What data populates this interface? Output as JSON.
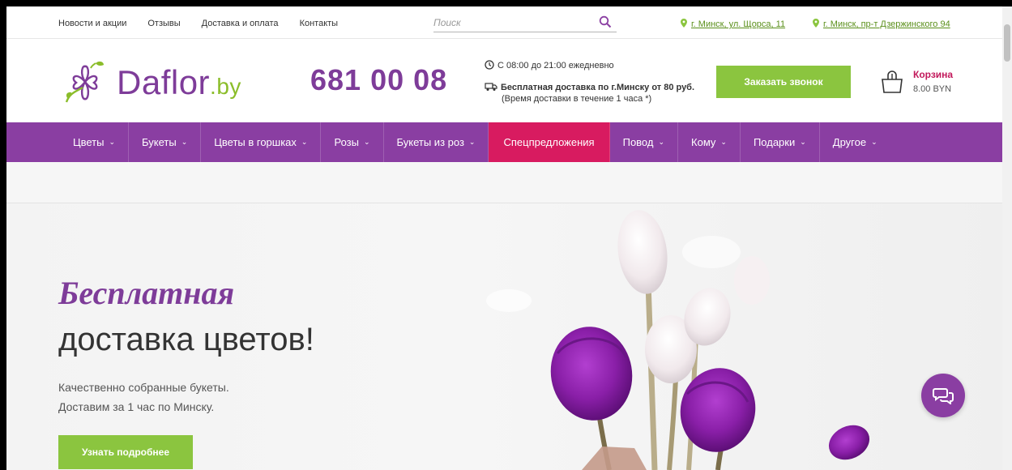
{
  "topbar": {
    "links": [
      "Новости и акции",
      "Отзывы",
      "Доставка и оплата",
      "Контакты"
    ],
    "search_placeholder": "Поиск",
    "address_1": "г. Минск, ул. Щорса, 11",
    "address_2": "г. Минск, пр-т Дзержинского 94"
  },
  "header": {
    "logo_main": "Daflor",
    "logo_tld": ".by",
    "phone": "681 00 08",
    "hours": "С 08:00 до 21:00 ежедневно",
    "delivery": "Бесплатная доставка по г.Минску от 80 руб.",
    "delivery_sub": "(Время доставки в течение 1 часа *)",
    "call_button": "Заказать звонок",
    "cart_label": "Корзина",
    "cart_sum": "8.00 BYN"
  },
  "nav": {
    "items": [
      "Цветы",
      "Букеты",
      "Цветы в горшках",
      "Розы",
      "Букеты из роз",
      "Спецпредложения",
      "Повод",
      "Кому",
      "Подарки",
      "Другое"
    ]
  },
  "hero": {
    "title_1": "Бесплатная",
    "title_2": "доставка цветов!",
    "line_1": "Качественно собранные букеты.",
    "line_2": "Доставим за 1 час по Минску.",
    "button": "Узнать подробнее"
  },
  "colors": {
    "brand_purple": "#8a3ea2",
    "accent_green": "#8bc53f",
    "special_pink": "#d81b60"
  }
}
